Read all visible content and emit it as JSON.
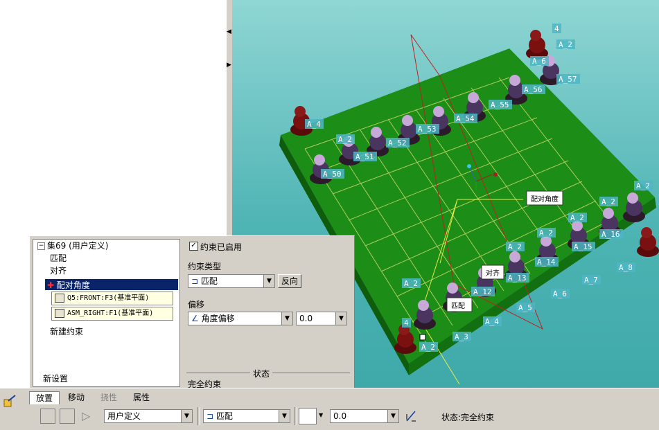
{
  "tree": {
    "root_label": "集69 (用户定义)",
    "items": [
      "匹配",
      "对齐",
      "配对角度"
    ],
    "refs": [
      "Q5:FRONT:F3(基准平面)",
      "ASM_RIGHT:F1(基准平面)"
    ],
    "new_constraint": "新建约束",
    "new_set": "新设置"
  },
  "constraint": {
    "enabled_label": "约束已启用",
    "type_label": "约束类型",
    "type_value": "匹配",
    "flip_button": "反向",
    "offset_label": "偏移",
    "offset_type": "角度偏移",
    "offset_value": "0.0",
    "status_label": "状态",
    "status_value": "完全约束"
  },
  "toolbar": {
    "tabs": [
      "放置",
      "移动",
      "挠性",
      "属性"
    ],
    "set_type": "用户定义",
    "constraint_type": "匹配",
    "offset_value": "0.0",
    "status": "状态:完全约束"
  },
  "viewport": {
    "callouts": [
      "配对角度",
      "对齐",
      "匹配"
    ],
    "piece_labels_top": [
      "4",
      "A_2",
      "A_6",
      "A_57",
      "A_56",
      "A_55",
      "A_54",
      "A_53",
      "A_52",
      "A_51",
      "A_50",
      "A_4",
      "A_2"
    ],
    "piece_labels_bottom": [
      "A_2",
      "A_16",
      "A_15",
      "A_14",
      "A_13",
      "A_12",
      "A_2",
      "A_2",
      "A_2",
      "A_2",
      "A_2",
      "A_8",
      "A_7",
      "A_6",
      "A_5",
      "A_4",
      "A_3",
      "A_2",
      "4"
    ]
  },
  "colors": {
    "board": "#1a8a14",
    "background": "#5bbdbc",
    "selection": "#0a246a"
  }
}
